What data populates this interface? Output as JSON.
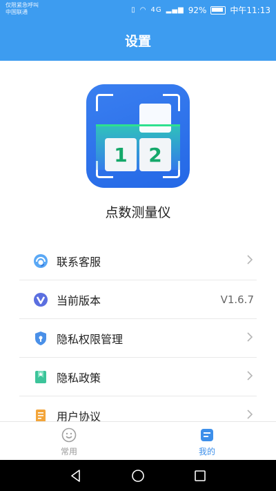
{
  "status_bar": {
    "carrier_line1": "仅限紧急呼叫",
    "carrier_line2": "中国联通",
    "network": "4G",
    "battery": "92%",
    "time": "中午11:13"
  },
  "header": {
    "title": "设置"
  },
  "app": {
    "name": "点数测量仪",
    "logo_digits": [
      "1",
      "2"
    ]
  },
  "menu": [
    {
      "label": "联系客服",
      "icon": "headset-support-icon",
      "value": "",
      "chevron": ">"
    },
    {
      "label": "当前版本",
      "icon": "version-v-icon",
      "value": "V1.6.7",
      "chevron": ""
    },
    {
      "label": "隐私权限管理",
      "icon": "shield-lock-icon",
      "value": "",
      "chevron": ">"
    },
    {
      "label": "隐私政策",
      "icon": "bookmark-star-icon",
      "value": "",
      "chevron": ">"
    },
    {
      "label": "用户协议",
      "icon": "document-icon",
      "value": "",
      "chevron": ">"
    }
  ],
  "tabbar": {
    "tabs": [
      {
        "label": "常用",
        "icon": "smile-face-icon",
        "active": false
      },
      {
        "label": "我的",
        "icon": "profile-card-icon",
        "active": true
      }
    ]
  },
  "colors": {
    "primary": "#3d9cf0",
    "active_tab": "#3d8fea",
    "inactive_tab": "#9a9a9a",
    "logo_green": "#14a86a"
  }
}
